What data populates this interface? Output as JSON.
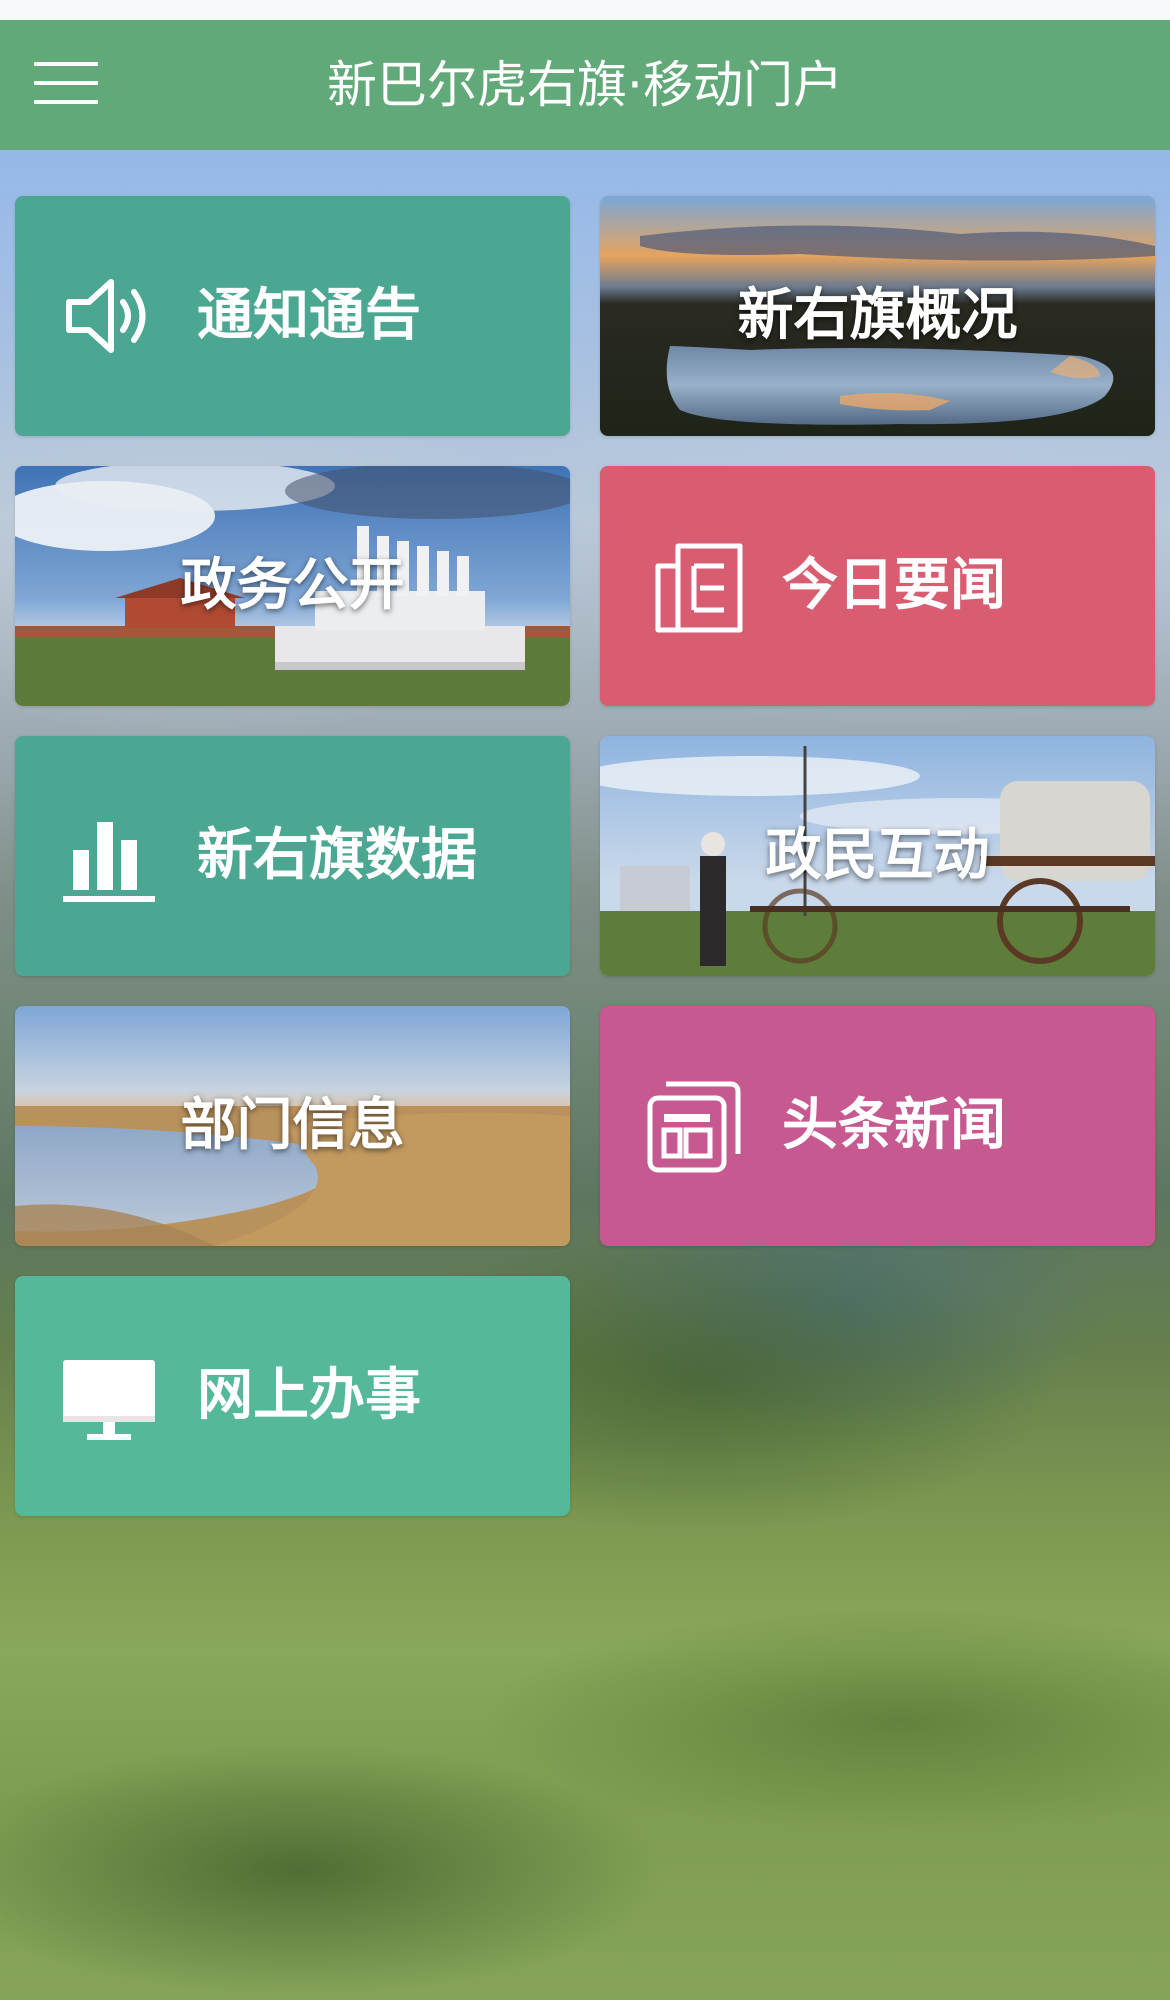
{
  "header": {
    "title": "新巴尔虎右旗·移动门户",
    "menu_icon": "hamburger-menu-icon",
    "color": "#61a978"
  },
  "tiles": [
    {
      "label": "通知通告",
      "icon": "speaker-icon",
      "color": "#4ba792"
    },
    {
      "label": "新右旗概况",
      "icon": "sunset-lake-photo"
    },
    {
      "label": "政务公开",
      "icon": "temple-stupa-photo"
    },
    {
      "label": "今日要闻",
      "icon": "newspaper-icon",
      "color": "#d95d71"
    },
    {
      "label": "新右旗数据",
      "icon": "bar-chart-icon",
      "color": "#4ba792"
    },
    {
      "label": "政民互动",
      "icon": "herdsman-cart-photo"
    },
    {
      "label": "部门信息",
      "icon": "grassland-river-photo"
    },
    {
      "label": "头条新闻",
      "icon": "news-layout-icon",
      "color": "#c65990"
    },
    {
      "label": "网上办事",
      "icon": "monitor-icon",
      "color": "#56b89a"
    }
  ]
}
